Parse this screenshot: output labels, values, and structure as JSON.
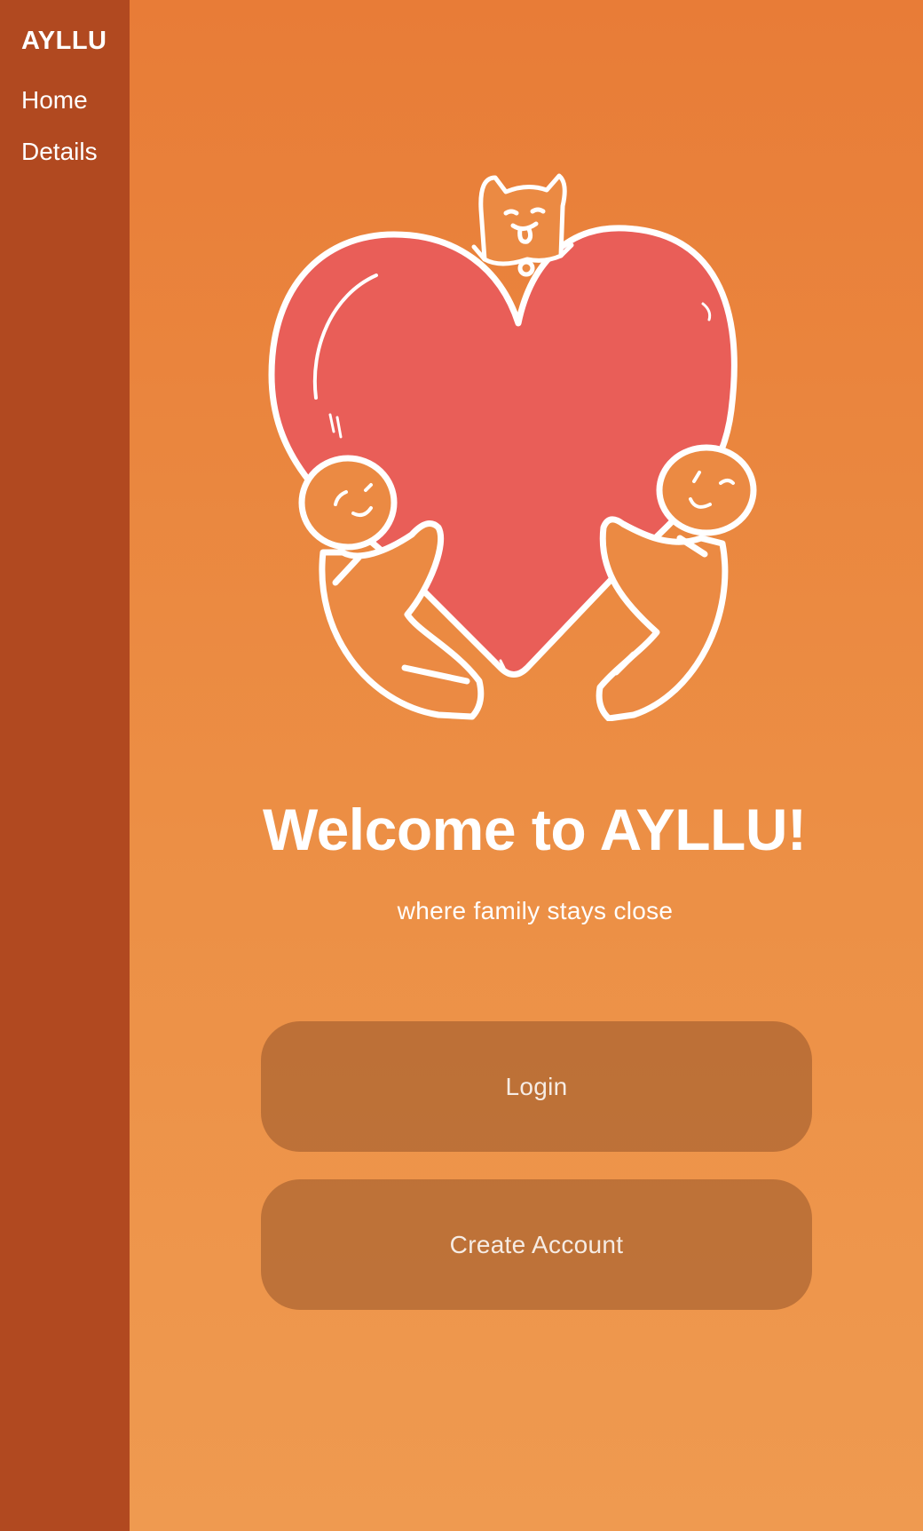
{
  "sidebar": {
    "brand": "AYLLU",
    "items": [
      {
        "label": "Home"
      },
      {
        "label": "Details"
      }
    ]
  },
  "main": {
    "title": "Welcome to AYLLU!",
    "subtitle": "where family stays close",
    "buttons": {
      "login": "Login",
      "create_account": "Create Account"
    }
  },
  "colors": {
    "sidebar": "#b14920",
    "background_top": "#e87c37",
    "background_bottom": "#ef9a50",
    "heart": "#e95e58",
    "button": "#b8703a"
  },
  "illustration": {
    "icons": [
      "heart-illustration",
      "dog-icon",
      "person-icon"
    ]
  }
}
